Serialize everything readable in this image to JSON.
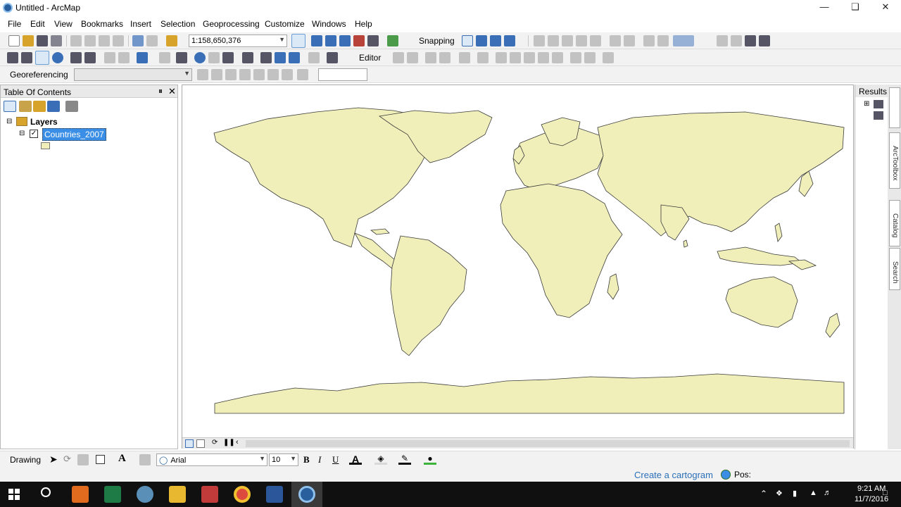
{
  "window": {
    "title": "Untitled - ArcMap"
  },
  "menu": [
    "File",
    "Edit",
    "View",
    "Bookmarks",
    "Insert",
    "Selection",
    "Geoprocessing",
    "Customize",
    "Windows",
    "Help"
  ],
  "toolbar": {
    "scale": "1:158,650,376",
    "snapping_label": "Snapping",
    "editor_label": "Editor",
    "georef_label": "Georeferencing"
  },
  "toc": {
    "title": "Table Of Contents",
    "root_label": "Layers",
    "layer_label": "Countries_2007",
    "fill_color": "#f0efb9"
  },
  "results": {
    "title": "Results"
  },
  "side_tabs": [
    "ArcToolbox",
    "Catalog",
    "Search"
  ],
  "drawing": {
    "label": "Drawing",
    "font": "Arial",
    "font_size": "10",
    "bold": "B",
    "italic": "I",
    "underline": "U",
    "text_tool": "A"
  },
  "status": {
    "link": "Create a cartogram",
    "pos_label": "Pos:"
  },
  "taskbar": {
    "time": "9:21 AM",
    "date": "11/7/2016"
  },
  "map": {
    "land_color": "#f0efb9",
    "outline_color": "#3a3a3a"
  }
}
